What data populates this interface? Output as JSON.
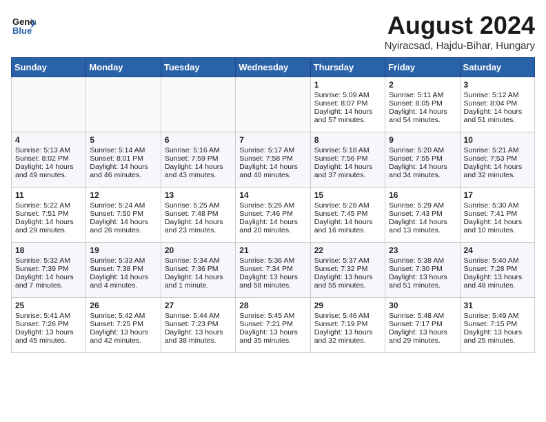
{
  "header": {
    "logo_general": "General",
    "logo_blue": "Blue",
    "month_year": "August 2024",
    "location": "Nyiracsad, Hajdu-Bihar, Hungary"
  },
  "days_of_week": [
    "Sunday",
    "Monday",
    "Tuesday",
    "Wednesday",
    "Thursday",
    "Friday",
    "Saturday"
  ],
  "weeks": [
    [
      {
        "day": "",
        "info": ""
      },
      {
        "day": "",
        "info": ""
      },
      {
        "day": "",
        "info": ""
      },
      {
        "day": "",
        "info": ""
      },
      {
        "day": "1",
        "info": "Sunrise: 5:09 AM\nSunset: 8:07 PM\nDaylight: 14 hours and 57 minutes."
      },
      {
        "day": "2",
        "info": "Sunrise: 5:11 AM\nSunset: 8:05 PM\nDaylight: 14 hours and 54 minutes."
      },
      {
        "day": "3",
        "info": "Sunrise: 5:12 AM\nSunset: 8:04 PM\nDaylight: 14 hours and 51 minutes."
      }
    ],
    [
      {
        "day": "4",
        "info": "Sunrise: 5:13 AM\nSunset: 8:02 PM\nDaylight: 14 hours and 49 minutes."
      },
      {
        "day": "5",
        "info": "Sunrise: 5:14 AM\nSunset: 8:01 PM\nDaylight: 14 hours and 46 minutes."
      },
      {
        "day": "6",
        "info": "Sunrise: 5:16 AM\nSunset: 7:59 PM\nDaylight: 14 hours and 43 minutes."
      },
      {
        "day": "7",
        "info": "Sunrise: 5:17 AM\nSunset: 7:58 PM\nDaylight: 14 hours and 40 minutes."
      },
      {
        "day": "8",
        "info": "Sunrise: 5:18 AM\nSunset: 7:56 PM\nDaylight: 14 hours and 37 minutes."
      },
      {
        "day": "9",
        "info": "Sunrise: 5:20 AM\nSunset: 7:55 PM\nDaylight: 14 hours and 34 minutes."
      },
      {
        "day": "10",
        "info": "Sunrise: 5:21 AM\nSunset: 7:53 PM\nDaylight: 14 hours and 32 minutes."
      }
    ],
    [
      {
        "day": "11",
        "info": "Sunrise: 5:22 AM\nSunset: 7:51 PM\nDaylight: 14 hours and 29 minutes."
      },
      {
        "day": "12",
        "info": "Sunrise: 5:24 AM\nSunset: 7:50 PM\nDaylight: 14 hours and 26 minutes."
      },
      {
        "day": "13",
        "info": "Sunrise: 5:25 AM\nSunset: 7:48 PM\nDaylight: 14 hours and 23 minutes."
      },
      {
        "day": "14",
        "info": "Sunrise: 5:26 AM\nSunset: 7:46 PM\nDaylight: 14 hours and 20 minutes."
      },
      {
        "day": "15",
        "info": "Sunrise: 5:28 AM\nSunset: 7:45 PM\nDaylight: 14 hours and 16 minutes."
      },
      {
        "day": "16",
        "info": "Sunrise: 5:29 AM\nSunset: 7:43 PM\nDaylight: 14 hours and 13 minutes."
      },
      {
        "day": "17",
        "info": "Sunrise: 5:30 AM\nSunset: 7:41 PM\nDaylight: 14 hours and 10 minutes."
      }
    ],
    [
      {
        "day": "18",
        "info": "Sunrise: 5:32 AM\nSunset: 7:39 PM\nDaylight: 14 hours and 7 minutes."
      },
      {
        "day": "19",
        "info": "Sunrise: 5:33 AM\nSunset: 7:38 PM\nDaylight: 14 hours and 4 minutes."
      },
      {
        "day": "20",
        "info": "Sunrise: 5:34 AM\nSunset: 7:36 PM\nDaylight: 14 hours and 1 minute."
      },
      {
        "day": "21",
        "info": "Sunrise: 5:36 AM\nSunset: 7:34 PM\nDaylight: 13 hours and 58 minutes."
      },
      {
        "day": "22",
        "info": "Sunrise: 5:37 AM\nSunset: 7:32 PM\nDaylight: 13 hours and 55 minutes."
      },
      {
        "day": "23",
        "info": "Sunrise: 5:38 AM\nSunset: 7:30 PM\nDaylight: 13 hours and 51 minutes."
      },
      {
        "day": "24",
        "info": "Sunrise: 5:40 AM\nSunset: 7:28 PM\nDaylight: 13 hours and 48 minutes."
      }
    ],
    [
      {
        "day": "25",
        "info": "Sunrise: 5:41 AM\nSunset: 7:26 PM\nDaylight: 13 hours and 45 minutes."
      },
      {
        "day": "26",
        "info": "Sunrise: 5:42 AM\nSunset: 7:25 PM\nDaylight: 13 hours and 42 minutes."
      },
      {
        "day": "27",
        "info": "Sunrise: 5:44 AM\nSunset: 7:23 PM\nDaylight: 13 hours and 38 minutes."
      },
      {
        "day": "28",
        "info": "Sunrise: 5:45 AM\nSunset: 7:21 PM\nDaylight: 13 hours and 35 minutes."
      },
      {
        "day": "29",
        "info": "Sunrise: 5:46 AM\nSunset: 7:19 PM\nDaylight: 13 hours and 32 minutes."
      },
      {
        "day": "30",
        "info": "Sunrise: 5:48 AM\nSunset: 7:17 PM\nDaylight: 13 hours and 29 minutes."
      },
      {
        "day": "31",
        "info": "Sunrise: 5:49 AM\nSunset: 7:15 PM\nDaylight: 13 hours and 25 minutes."
      }
    ]
  ]
}
